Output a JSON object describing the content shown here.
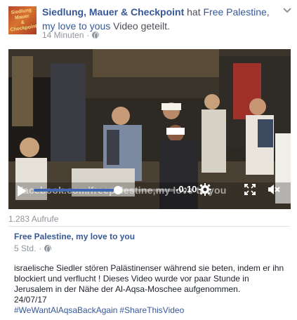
{
  "post": {
    "author": "Siedlung, Mauer & Checkpoint",
    "action_text": " hat ",
    "shared_from": "Free Palestine, my love to yous",
    "object_text": " Video",
    "verb": " geteilt.",
    "time": "14 Minuten",
    "separator": "·"
  },
  "video": {
    "time_display": "-0:10",
    "progress": 0.6,
    "watermark": "facebook.com/freepalestine,my love to you"
  },
  "views": "1.283 Aufrufe",
  "shared_post": {
    "name": "Free Palestine, my love to you",
    "time": "5 Std.",
    "separator": "·",
    "text": "israelische Siedler stören Palästinenser während sie beten, indem er ihn blockiert und verflucht ! Dieses Video wurde vor paar Stunde in Jerusalem in der Nähe der Al-Aqsa-Moschee aufgenommen.",
    "date": "24/07/17",
    "hashtags": [
      "#WeWantAlAqsaBackAgain",
      "#ShareThisVideo"
    ]
  },
  "icons": {
    "privacy": "globe-icon",
    "menu": "chevron-down-icon",
    "play": "play-icon",
    "settings": "gear-icon",
    "fullscreen": "expand-icon",
    "volume": "mute-icon"
  }
}
